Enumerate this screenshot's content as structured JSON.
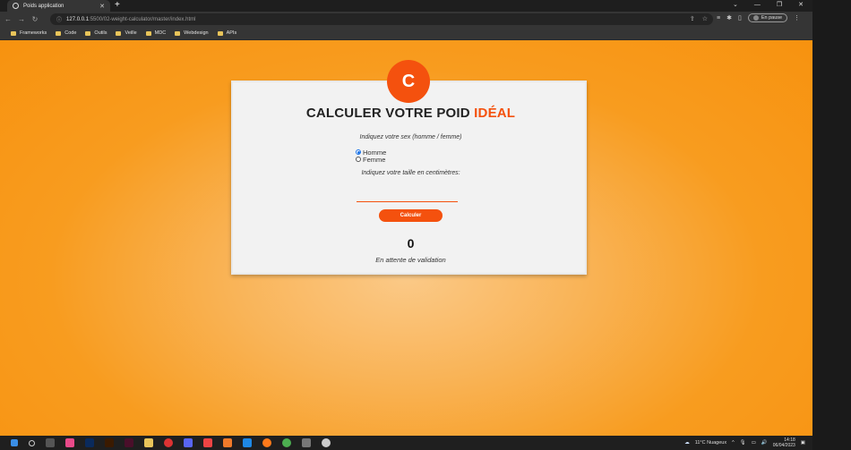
{
  "browser": {
    "tab_title": "Poids application",
    "tab_close": "✕",
    "new_tab": "+",
    "url_host": "127.0.0.1",
    "url_path": ":5500/02-weight-calculator/master/index.html",
    "pause_label": "En pause",
    "bookmarks": [
      "Frameworks",
      "Code",
      "Outils",
      "Veille",
      "MDC",
      "Webdesign",
      "APIs"
    ]
  },
  "app": {
    "logo_letter": "C",
    "title_main": "CALCULER VOTRE POID ",
    "title_accent": "IDÉAL",
    "accent_color": "#f4510e",
    "sex_question": "Indiquez votre sex (homme / femme)",
    "option_male": "Homme",
    "option_female": "Femme",
    "height_question": "Indiquez votre taille en centimètres:",
    "height_value": "",
    "calc_button": "Calculer",
    "result_value": "0",
    "status_text": "En attente de validation"
  },
  "taskbar": {
    "weather": "11°C Nuageux",
    "time": "14:18",
    "date": "06/04/2023"
  }
}
